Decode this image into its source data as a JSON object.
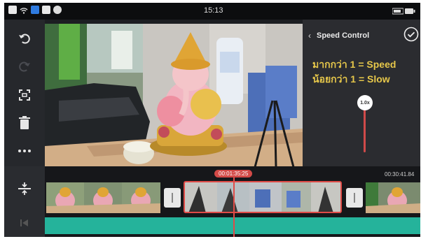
{
  "status_bar": {
    "time": "15:13"
  },
  "toolbar": {
    "undo": "undo-icon",
    "redo": "redo-icon",
    "crop": "crop-icon",
    "delete": "trash-icon",
    "more": "more-icon"
  },
  "speed_panel": {
    "back_icon": "‹",
    "title": "Speed Control",
    "line1": "มากกว่า 1 = Speed",
    "line2": "น้อยกว่า 1 = Slow",
    "knob_label": "1.0x",
    "speed_value": 1.0
  },
  "timeline": {
    "current_timecode": "00:01:35:25",
    "total_duration": "00:30:41.84"
  },
  "colors": {
    "accent": "#e04b47",
    "audio": "#25b39b",
    "speed_text": "#e6c74a"
  }
}
